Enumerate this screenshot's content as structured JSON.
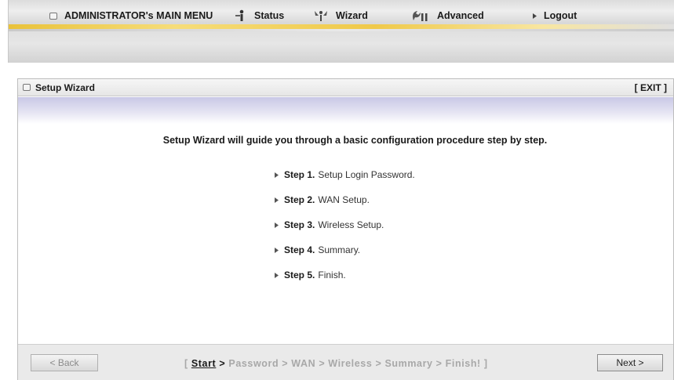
{
  "menu": {
    "items": [
      {
        "label": "ADMINISTRATOR's MAIN MENU",
        "icon": "box-icon"
      },
      {
        "label": "Status",
        "icon": "person-icon"
      },
      {
        "label": "Wizard",
        "icon": "wizard-icon"
      },
      {
        "label": "Advanced",
        "icon": "tools-icon"
      },
      {
        "label": "Logout",
        "icon": "caret-right-icon"
      }
    ]
  },
  "panel": {
    "title": "Setup Wizard",
    "exit_label": "[ EXIT ]",
    "intro": "Setup Wizard will guide you through a basic configuration procedure step by step."
  },
  "steps": [
    {
      "num": "Step 1.",
      "text": "Setup Login Password."
    },
    {
      "num": "Step 2.",
      "text": "WAN Setup."
    },
    {
      "num": "Step 3.",
      "text": "Wireless Setup."
    },
    {
      "num": "Step 4.",
      "text": "Summary."
    },
    {
      "num": "Step 5.",
      "text": "Finish."
    }
  ],
  "footer": {
    "back_label": "< Back",
    "next_label": "Next >",
    "progress": {
      "open": "[ ",
      "current": "Start",
      "sep_after_current": " >",
      "rest": " Password > WAN > Wireless > Summary > Finish! ]"
    }
  },
  "colors": {
    "accent_gold": "#e9c23a",
    "lavender": "#c9c8e6",
    "footer_bg": "#eaeaea"
  }
}
